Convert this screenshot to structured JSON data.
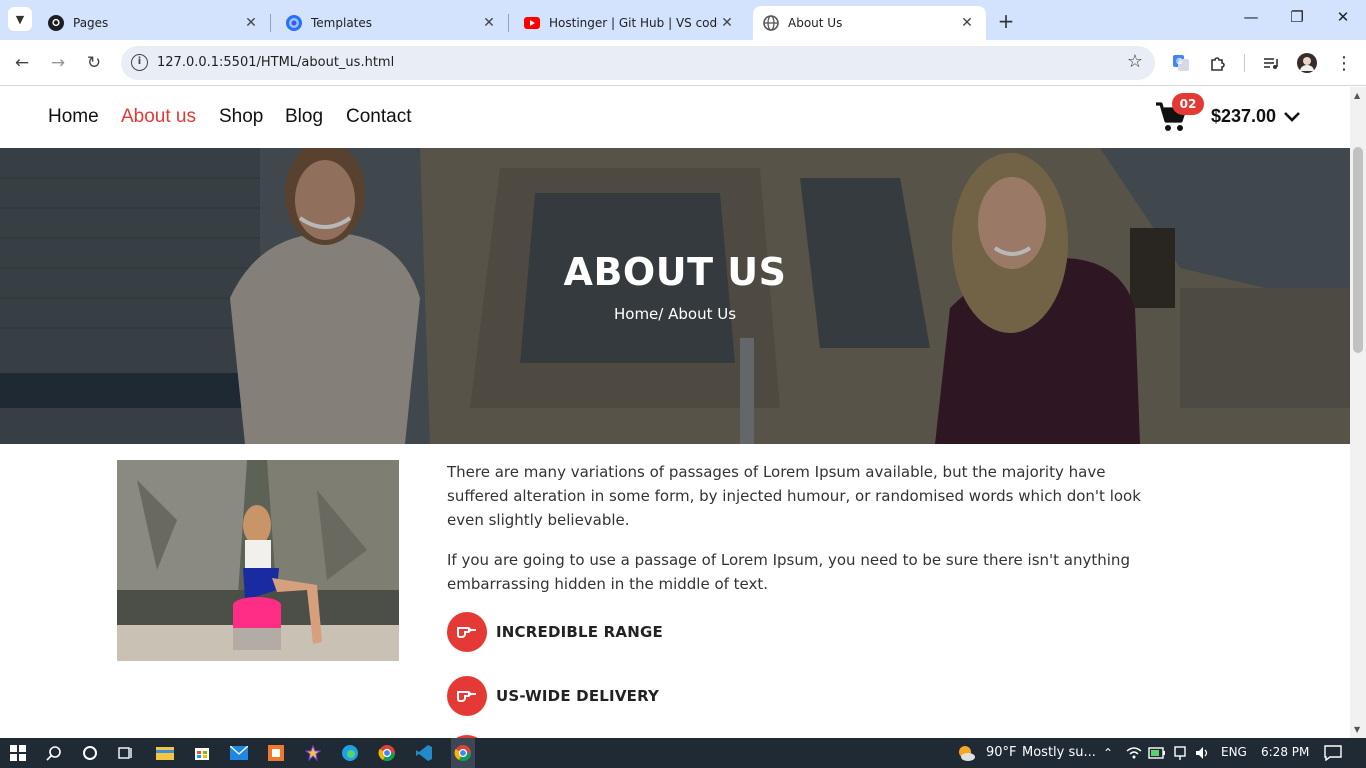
{
  "browser": {
    "tabs": [
      {
        "title": "Pages",
        "icon": "github-icon"
      },
      {
        "title": "Templates",
        "icon": "templates-icon"
      },
      {
        "title": "Hostinger | Git Hub | VS codeH...",
        "icon": "youtube-icon"
      },
      {
        "title": "About Us",
        "icon": "globe-icon",
        "active": true
      }
    ],
    "url": "127.0.0.1:5501/HTML/about_us.html"
  },
  "site_nav": {
    "items": [
      {
        "label": "Home",
        "active": false
      },
      {
        "label": "About us",
        "active": true
      },
      {
        "label": "Shop",
        "active": false
      },
      {
        "label": "Blog",
        "active": false
      },
      {
        "label": "Contact",
        "active": false
      }
    ],
    "cart_count": "02",
    "cart_total": "$237.00"
  },
  "hero": {
    "title": "ABOUT US",
    "breadcrumb": "Home/ About Us"
  },
  "content": {
    "paragraph_1": "  There are many variations of passages of Lorem Ipsum available, but the majority have suffered alteration in some form, by injected humour, or randomised words which don't look even slightly believable.",
    "paragraph_2": "If you are going to use a passage of Lorem Ipsum, you need to be sure there isn't anything embarrassing hidden in the middle of text.",
    "features": [
      {
        "label": "INCREDIBLE RANGE"
      },
      {
        "label": "US-WIDE DELIVERY"
      }
    ]
  },
  "taskbar": {
    "weather_temp": "90°F",
    "weather_desc": "Mostly su...",
    "language": "ENG",
    "time": "6:28 PM"
  },
  "colors": {
    "accent": "#e53935",
    "tab_strip": "#d3e3fd",
    "taskbar": "#1f2a35"
  }
}
